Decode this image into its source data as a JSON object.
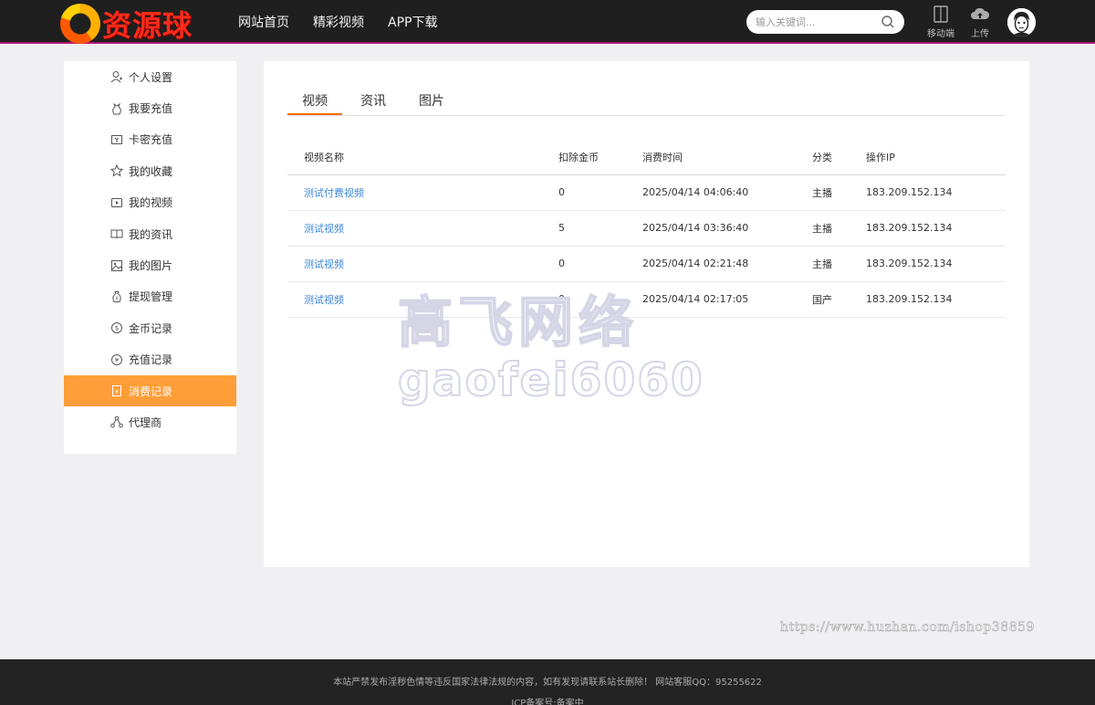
{
  "header": {
    "logo_text": "资源球",
    "nav": [
      "网站首页",
      "精彩视频",
      "APP下载"
    ],
    "search_placeholder": "输入关键词...",
    "mobile_label": "移动端",
    "upload_label": "上传"
  },
  "sidebar": {
    "items": [
      {
        "label": "个人设置",
        "icon": "user-icon"
      },
      {
        "label": "我要充值",
        "icon": "money-bag-icon"
      },
      {
        "label": "卡密充值",
        "icon": "card-icon"
      },
      {
        "label": "我的收藏",
        "icon": "star-icon"
      },
      {
        "label": "我的视频",
        "icon": "video-icon"
      },
      {
        "label": "我的资讯",
        "icon": "book-icon"
      },
      {
        "label": "我的图片",
        "icon": "image-icon"
      },
      {
        "label": "提现管理",
        "icon": "wallet-icon"
      },
      {
        "label": "金币记录",
        "icon": "coin-icon"
      },
      {
        "label": "充值记录",
        "icon": "yen-icon"
      },
      {
        "label": "消费记录",
        "icon": "receipt-icon",
        "active": true
      },
      {
        "label": "代理商",
        "icon": "network-icon"
      }
    ]
  },
  "main": {
    "tabs": [
      "视频",
      "资讯",
      "图片"
    ],
    "active_tab": 0,
    "columns": [
      "视频名称",
      "扣除金币",
      "消费时间",
      "分类",
      "操作IP"
    ],
    "rows": [
      [
        "测试付费视频",
        "0",
        "2025/04/14 04:06:40",
        "主播",
        "183.209.152.134"
      ],
      [
        "测试视频",
        "5",
        "2025/04/14 03:36:40",
        "主播",
        "183.209.152.134"
      ],
      [
        "测试视频",
        "0",
        "2025/04/14 02:21:48",
        "主播",
        "183.209.152.134"
      ],
      [
        "测试视频",
        "0",
        "2025/04/14 02:17:05",
        "国产",
        "183.209.152.134"
      ]
    ]
  },
  "watermark": {
    "line1": "高飞网络",
    "line2": "gaofei6060"
  },
  "credit": "https://www.huzhan.com/ishop38859",
  "footer": {
    "notice": "本站严禁发布淫秽色情等违反国家法律法规的内容，如有发现请联系站长删除！ 网站客服QQ：95255622",
    "icp": "ICP备案号:备案中"
  },
  "colors": {
    "accent": "#ff9e38",
    "tab_underline": "#ff6a00",
    "link": "#3a86d8",
    "header_bg": "#1f1f1f"
  }
}
